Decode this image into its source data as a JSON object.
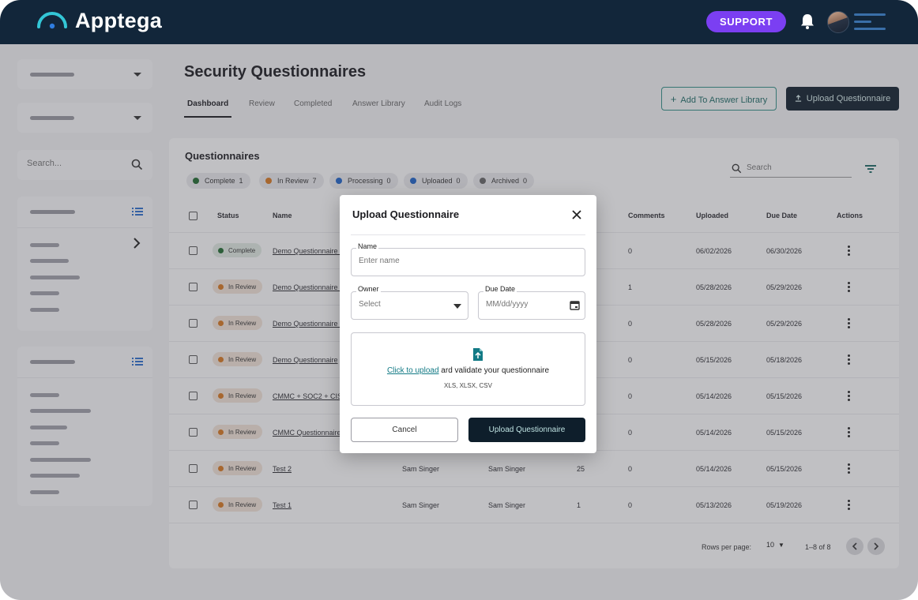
{
  "app": {
    "brand": "Apptega",
    "support_label": "SUPPORT"
  },
  "sidebar": {
    "search_placeholder": "Search..."
  },
  "page": {
    "title": "Security Questionnaires",
    "tabs": [
      {
        "label": "Dashboard",
        "active": true
      },
      {
        "label": "Review"
      },
      {
        "label": "Completed"
      },
      {
        "label": "Answer Library"
      },
      {
        "label": "Audit Logs"
      }
    ],
    "add_library_label": "Add To Answer Library",
    "upload_label": "Upload Questionnaire"
  },
  "table": {
    "title": "Questionnaires",
    "filters": [
      {
        "label": "Complete",
        "count": "1",
        "color": "#1f6b2e"
      },
      {
        "label": "In Review",
        "count": "7",
        "color": "#d9781f"
      },
      {
        "label": "Processing",
        "count": "0",
        "color": "#1e63c9"
      },
      {
        "label": "Uploaded",
        "count": "0",
        "color": "#1e63c9"
      },
      {
        "label": "Archived",
        "count": "0",
        "color": "#666666"
      }
    ],
    "search_placeholder": "Search",
    "columns": {
      "status": "Status",
      "name": "Name",
      "comments": "Comments",
      "uploaded": "Uploaded",
      "due_date": "Due Date",
      "actions": "Actions"
    },
    "rows": [
      {
        "status": "Complete",
        "name": "Demo Questionnaire 5",
        "owner": "",
        "assignee": "",
        "questions": "",
        "comments": "0",
        "uploaded": "06/02/2026",
        "due": "06/30/2026"
      },
      {
        "status": "In Review",
        "name": "Demo Questionnaire 3",
        "owner": "",
        "assignee": "",
        "questions": "",
        "comments": "1",
        "uploaded": "05/28/2026",
        "due": "05/29/2026"
      },
      {
        "status": "In Review",
        "name": "Demo Questionnaire 2",
        "owner": "",
        "assignee": "",
        "questions": "",
        "comments": "0",
        "uploaded": "05/28/2026",
        "due": "05/29/2026"
      },
      {
        "status": "In Review",
        "name": "Demo Questionnaire",
        "owner": "",
        "assignee": "",
        "questions": "",
        "comments": "0",
        "uploaded": "05/15/2026",
        "due": "05/18/2026"
      },
      {
        "status": "In Review",
        "name": "CMMC + SOC2 + CIS V8",
        "owner": "",
        "assignee": "",
        "questions": "",
        "comments": "0",
        "uploaded": "05/14/2026",
        "due": "05/15/2026"
      },
      {
        "status": "In Review",
        "name": "CMMC Questionnaire Test",
        "owner": "",
        "assignee": "",
        "questions": "",
        "comments": "0",
        "uploaded": "05/14/2026",
        "due": "05/15/2026"
      },
      {
        "status": "In Review",
        "name": "Test 2",
        "owner": "Sam Singer",
        "assignee": "Sam Singer",
        "questions": "25",
        "comments": "0",
        "uploaded": "05/14/2026",
        "due": "05/15/2026"
      },
      {
        "status": "In Review",
        "name": "Test 1",
        "owner": "Sam Singer",
        "assignee": "Sam Singer",
        "questions": "1",
        "comments": "0",
        "uploaded": "05/13/2026",
        "due": "05/19/2026"
      }
    ],
    "rows_per_page_label": "Rows per page:",
    "rows_per_page_value": "10",
    "range": "1–8 of 8"
  },
  "modal": {
    "title": "Upload Questionnaire",
    "name_label": "Name",
    "name_placeholder": "Enter name",
    "owner_label": "Owner",
    "owner_placeholder": "Select",
    "due_label": "Due Date",
    "due_placeholder": "MM/dd/yyyy",
    "upload_link": "Click to upload",
    "upload_text": " ard validate your questionnaire",
    "formats": "XLS, XLSX, CSV",
    "cancel_label": "Cancel",
    "submit_label": "Upload Questionnaire"
  },
  "colors": {
    "topbar": "#12263a",
    "support": "#7b3ff2",
    "accent_teal": "#2f8f86",
    "dark_button": "#0e1e2b"
  },
  "icons": [
    "bell-icon",
    "hamburger-icon",
    "search-icon",
    "list-icon",
    "chevron-right-icon",
    "filter-icon",
    "plus-icon",
    "upload-icon",
    "close-icon",
    "calendar-icon",
    "file-upload-icon",
    "kebab-icon"
  ]
}
